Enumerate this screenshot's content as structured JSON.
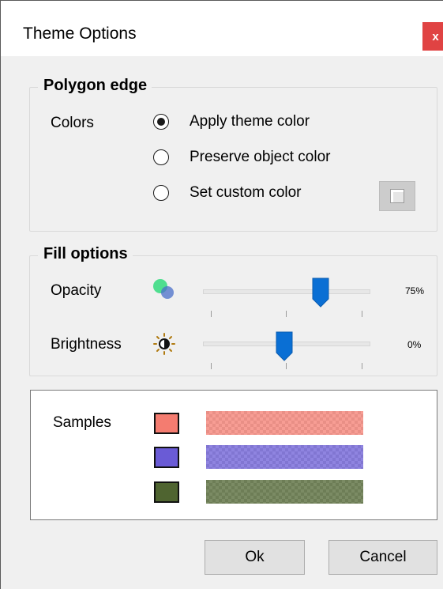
{
  "window": {
    "title": "Theme Options",
    "close_label": "x"
  },
  "polygon_edge": {
    "title": "Polygon edge",
    "colors_label": "Colors",
    "options": [
      {
        "label": "Apply theme color",
        "selected": true
      },
      {
        "label": "Preserve object color",
        "selected": false
      },
      {
        "label": "Set custom color",
        "selected": false
      }
    ],
    "custom_color_icon": "color-swatch-icon"
  },
  "fill_options": {
    "title": "Fill options",
    "opacity": {
      "label": "Opacity",
      "value_text": "75%",
      "level": 0.75,
      "icon": "opacity-circles-icon"
    },
    "brightness": {
      "label": "Brightness",
      "value_text": "0%",
      "level": 0.5,
      "icon": "brightness-icon"
    }
  },
  "samples": {
    "label": "Samples",
    "items": [
      {
        "color": "#f47c70"
      },
      {
        "color": "#6a5bd6"
      },
      {
        "color": "#4f6430"
      }
    ]
  },
  "buttons": {
    "ok": "Ok",
    "cancel": "Cancel"
  },
  "colors": {
    "accent": "#0a6fd4",
    "close": "#e04343"
  }
}
